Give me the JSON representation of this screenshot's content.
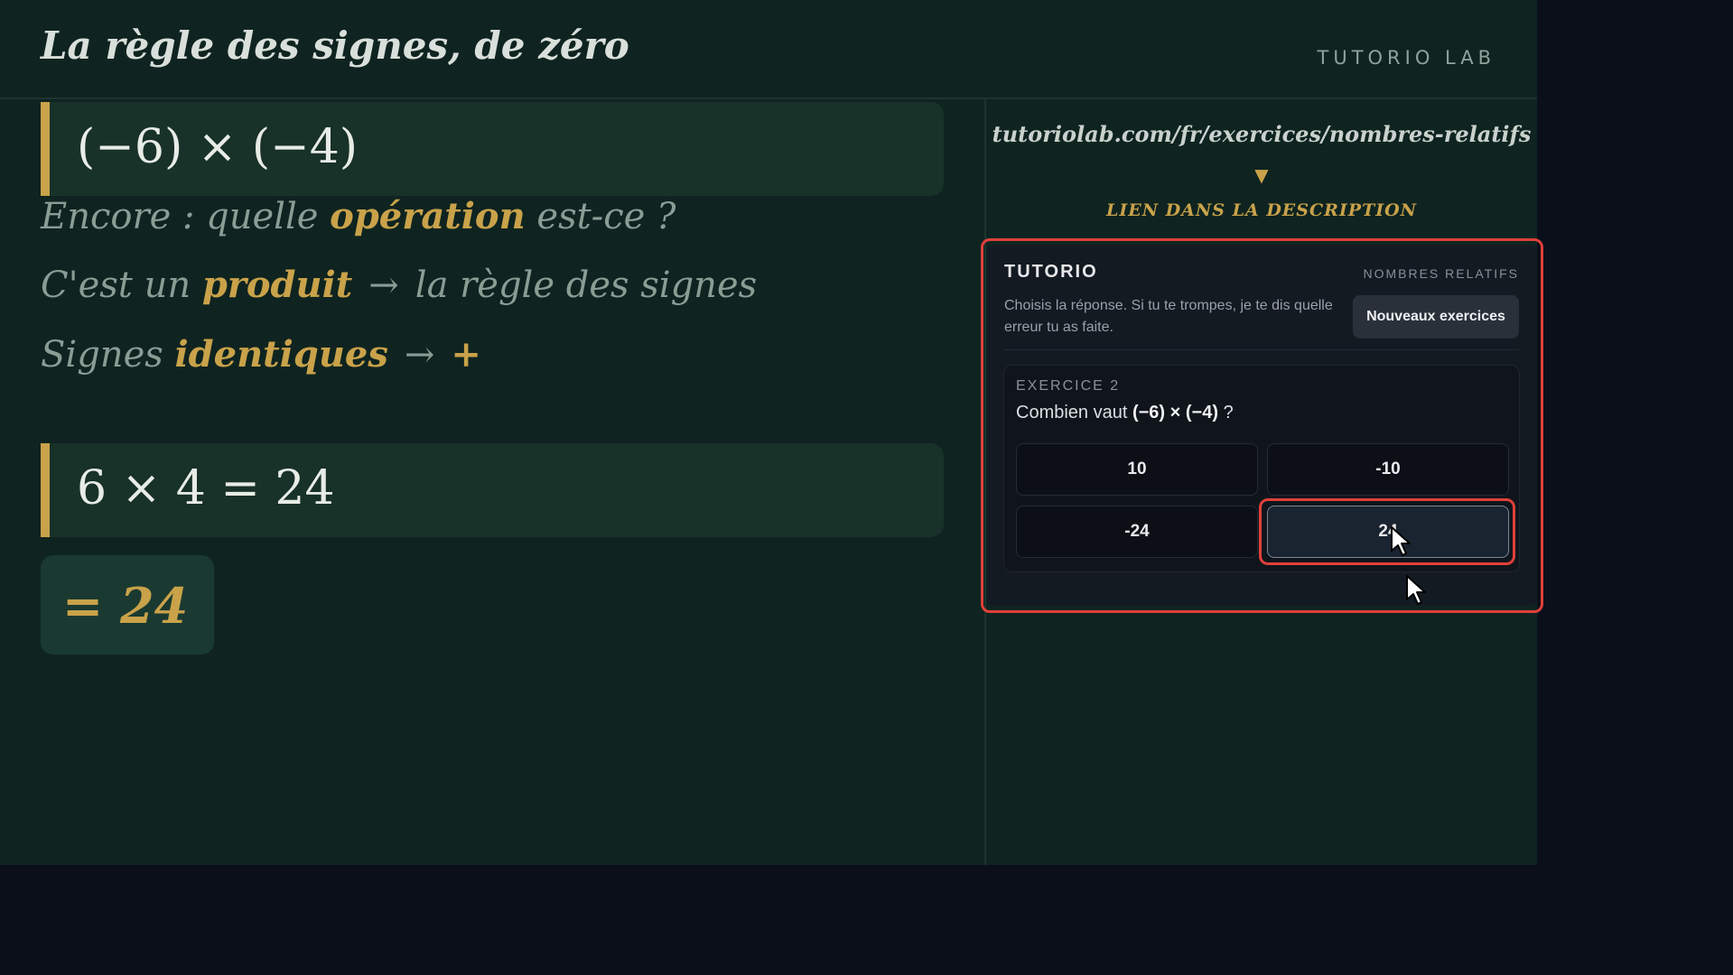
{
  "header": {
    "title": "La règle des signes, de zéro",
    "brand": "TUTORIO LAB"
  },
  "lesson": {
    "expression": "(−6) × (−4)",
    "line1": {
      "pre": "Encore : quelle ",
      "hl": "opération",
      "post": " est-ce ?"
    },
    "line2": {
      "pre": "C'est un ",
      "hl": "produit",
      "arrow": "→",
      "post": "la règle des signes"
    },
    "line3": {
      "pre": "Signes ",
      "hl": "identiques",
      "arrow": "→",
      "post": "+"
    },
    "calculation": "6 × 4 = 24",
    "result": "= 24"
  },
  "promo": {
    "url": "tutoriolab.com/fr/exercices/nombres-relatifs",
    "arrow_icon": "▼",
    "link_note": "LIEN DANS LA DESCRIPTION"
  },
  "widget": {
    "title": "TUTORIO",
    "topic": "NOMBRES RELATIFS",
    "description": "Choisis la réponse. Si tu te trompes, je te dis quelle erreur tu as faite.",
    "new_button": "Nouveaux exercices",
    "exercise": {
      "label": "EXERCICE 2",
      "question_pre": "Combien vaut ",
      "question_expr": "(−6) × (−4)",
      "question_post": " ?",
      "options": [
        "10",
        "-10",
        "-24",
        "24"
      ],
      "selected": "24"
    }
  },
  "colors": {
    "accent": "#c9a24a",
    "highlight_outline": "#e0403a",
    "board": "#0f2420"
  },
  "icons": {
    "cursor": "mouse-pointer-icon"
  }
}
